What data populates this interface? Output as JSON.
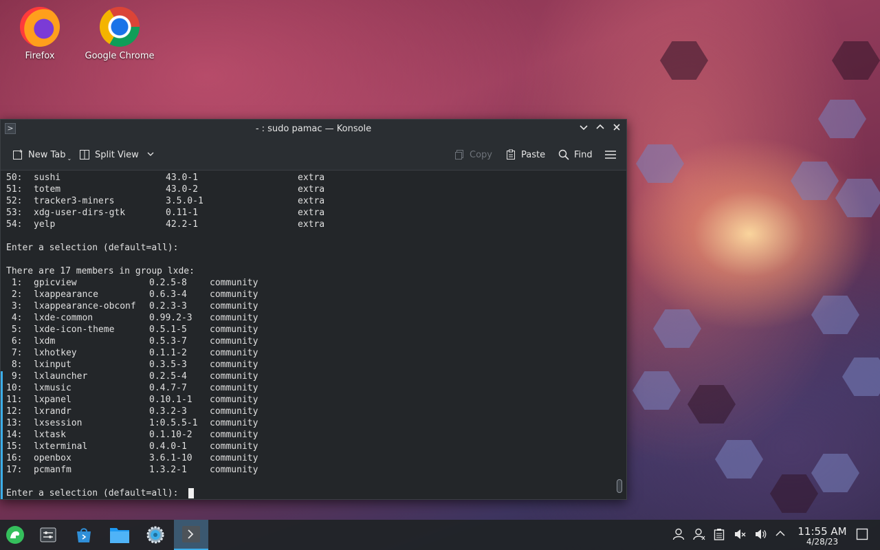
{
  "desktop": {
    "icons": [
      {
        "label": "Firefox",
        "icon": "firefox-icon"
      },
      {
        "label": "Google Chrome",
        "icon": "chrome-icon"
      }
    ]
  },
  "window": {
    "title": "- : sudo pamac — Konsole",
    "toolbar": {
      "new_tab": "New Tab",
      "split_view": "Split View",
      "copy": "Copy",
      "paste": "Paste",
      "find": "Find"
    }
  },
  "terminal": {
    "top_rows": [
      {
        "num": "50:",
        "name": "sushi",
        "version": "43.0-1",
        "repo": "extra"
      },
      {
        "num": "51:",
        "name": "totem",
        "version": "43.0-2",
        "repo": "extra"
      },
      {
        "num": "52:",
        "name": "tracker3-miners",
        "version": "3.5.0-1",
        "repo": "extra"
      },
      {
        "num": "53:",
        "name": "xdg-user-dirs-gtk",
        "version": "0.11-1",
        "repo": "extra"
      },
      {
        "num": "54:",
        "name": "yelp",
        "version": "42.2-1",
        "repo": "extra"
      }
    ],
    "prompt1": "Enter a selection (default=all):",
    "group_header": "There are 17 members in group lxde:",
    "group_rows": [
      {
        "num": " 1:",
        "name": "gpicview",
        "version": "0.2.5-8",
        "repo": "community"
      },
      {
        "num": " 2:",
        "name": "lxappearance",
        "version": "0.6.3-4",
        "repo": "community"
      },
      {
        "num": " 3:",
        "name": "lxappearance-obconf",
        "version": "0.2.3-3",
        "repo": "community"
      },
      {
        "num": " 4:",
        "name": "lxde-common",
        "version": "0.99.2-3",
        "repo": "community"
      },
      {
        "num": " 5:",
        "name": "lxde-icon-theme",
        "version": "0.5.1-5",
        "repo": "community"
      },
      {
        "num": " 6:",
        "name": "lxdm",
        "version": "0.5.3-7",
        "repo": "community"
      },
      {
        "num": " 7:",
        "name": "lxhotkey",
        "version": "0.1.1-2",
        "repo": "community"
      },
      {
        "num": " 8:",
        "name": "lxinput",
        "version": "0.3.5-3",
        "repo": "community"
      },
      {
        "num": " 9:",
        "name": "lxlauncher",
        "version": "0.2.5-4",
        "repo": "community"
      },
      {
        "num": "10:",
        "name": "lxmusic",
        "version": "0.4.7-7",
        "repo": "community"
      },
      {
        "num": "11:",
        "name": "lxpanel",
        "version": "0.10.1-1",
        "repo": "community"
      },
      {
        "num": "12:",
        "name": "lxrandr",
        "version": "0.3.2-3",
        "repo": "community"
      },
      {
        "num": "13:",
        "name": "lxsession",
        "version": "1:0.5.5-1",
        "repo": "community"
      },
      {
        "num": "14:",
        "name": "lxtask",
        "version": "0.1.10-2",
        "repo": "community"
      },
      {
        "num": "15:",
        "name": "lxterminal",
        "version": "0.4.0-1",
        "repo": "community"
      },
      {
        "num": "16:",
        "name": "openbox",
        "version": "3.6.1-10",
        "repo": "community"
      },
      {
        "num": "17:",
        "name": "pcmanfm",
        "version": "1.3.2-1",
        "repo": "community"
      }
    ],
    "prompt2": "Enter a selection (default=all): "
  },
  "taskbar": {
    "launchers": [
      "application-launcher-icon",
      "overview-icon",
      "discover-store-icon",
      "file-manager-icon",
      "system-settings-icon",
      "konsole-icon"
    ],
    "tray": [
      "user-icon",
      "kde-connect-icon",
      "clipboard-icon",
      "audio-muted-icon",
      "volume-icon",
      "expand-tray-icon"
    ],
    "time": "11:55 AM",
    "date": "4/28/23"
  },
  "colors": {
    "accent": "#3daee9",
    "terminal_bg": "#232629",
    "terminal_fg": "#e0e0e0"
  }
}
